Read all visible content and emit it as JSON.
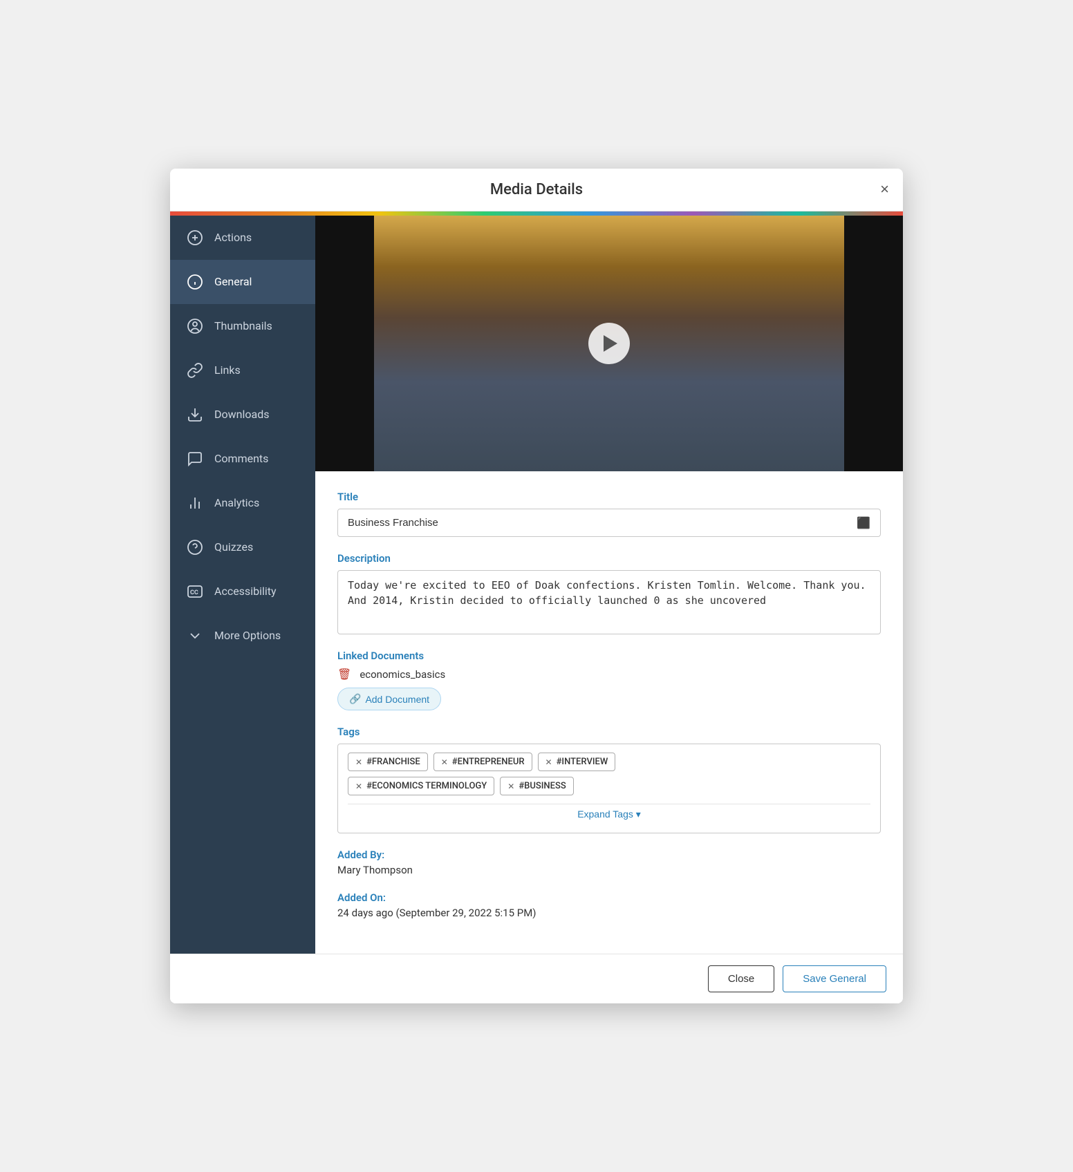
{
  "modal": {
    "title": "Media Details",
    "close_label": "×"
  },
  "sidebar": {
    "items": [
      {
        "id": "actions",
        "label": "Actions",
        "icon": "plus-circle"
      },
      {
        "id": "general",
        "label": "General",
        "icon": "info-circle",
        "active": true
      },
      {
        "id": "thumbnails",
        "label": "Thumbnails",
        "icon": "user-circle"
      },
      {
        "id": "links",
        "label": "Links",
        "icon": "link"
      },
      {
        "id": "downloads",
        "label": "Downloads",
        "icon": "download"
      },
      {
        "id": "comments",
        "label": "Comments",
        "icon": "chat"
      },
      {
        "id": "analytics",
        "label": "Analytics",
        "icon": "bar-chart"
      },
      {
        "id": "quizzes",
        "label": "Quizzes",
        "icon": "question-circle"
      },
      {
        "id": "accessibility",
        "label": "Accessibility",
        "icon": "cc"
      },
      {
        "id": "more-options",
        "label": "More Options",
        "icon": "chevron-down"
      }
    ]
  },
  "form": {
    "title_label": "Title",
    "title_value": "Business Franchise",
    "description_label": "Description",
    "description_value": "Today we're excited to EEO of Doak confections. Kristen Tomlin. Welcome. Thank you. And 2014, Kristin decided to officially launched 0 as she uncovered",
    "linked_docs_label": "Linked Documents",
    "linked_doc_name": "economics_basics",
    "add_doc_label": "Add Document",
    "tags_label": "Tags",
    "tags": [
      {
        "id": "franchise",
        "label": "#FRANCHISE"
      },
      {
        "id": "entrepreneur",
        "label": "#ENTREPRENEUR"
      },
      {
        "id": "interview",
        "label": "#INTERVIEW"
      },
      {
        "id": "economics",
        "label": "#ECONOMICS TERMINOLOGY"
      },
      {
        "id": "business",
        "label": "#BUSINESS"
      }
    ],
    "expand_tags_label": "Expand Tags ▾",
    "added_by_label": "Added By:",
    "added_by_value": "Mary Thompson",
    "added_on_label": "Added On:",
    "added_on_value": "24 days ago (September 29, 2022 5:15 PM)"
  },
  "footer": {
    "close_label": "Close",
    "save_label": "Save General"
  }
}
